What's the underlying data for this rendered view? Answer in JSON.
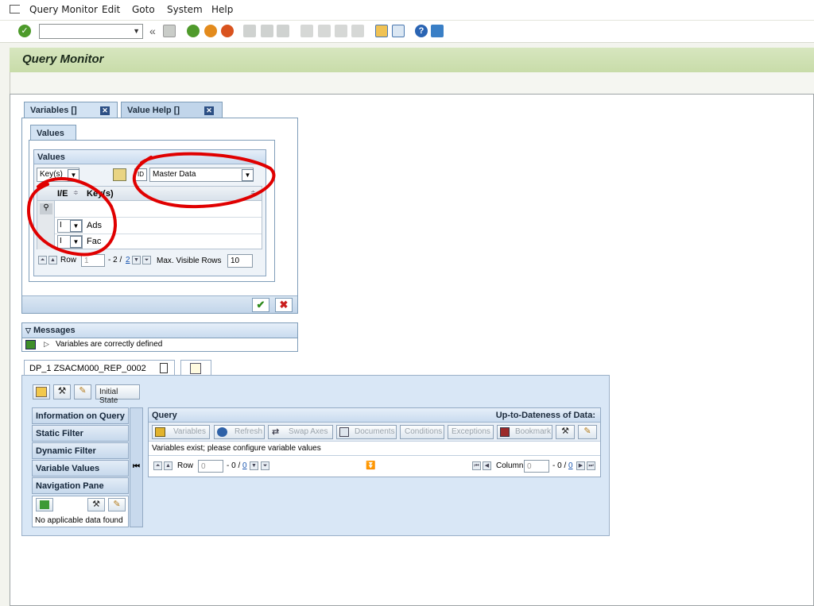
{
  "menu": {
    "items": [
      "Query Monitor",
      "Edit",
      "Goto",
      "System",
      "Help"
    ]
  },
  "toolbar": {
    "command_value": ""
  },
  "title": "Query Monitor",
  "tabs": [
    {
      "label": "Variables []"
    },
    {
      "label": "Value Help []"
    }
  ],
  "values_tab": "Values",
  "values_group": {
    "title": "Values",
    "key_select": "Key(s)",
    "id_label": "ID",
    "master_data_select": "Master Data",
    "columns": [
      "I/E",
      "Key(s)"
    ],
    "rows": [
      {
        "ie": "I",
        "key": "Ads"
      },
      {
        "ie": "I",
        "key": "Fac"
      }
    ],
    "nav": {
      "row_label": "Row",
      "row_value": "1",
      "count": "- 2 /",
      "total": "2",
      "max_label": "Max. Visible Rows",
      "max_value": "10"
    }
  },
  "messages": {
    "title": "Messages",
    "text": "Variables are correctly defined"
  },
  "dp_tab": {
    "label": "DP_1 ZSACM000_REP_0002"
  },
  "initial_state": "Initial State",
  "side_buttons": [
    "Information on Query",
    "Static Filter",
    "Dynamic Filter",
    "Variable Values",
    "Navigation Pane"
  ],
  "no_data": "No applicable data found",
  "query": {
    "title": "Query",
    "uptodate": "Up-to-Dateness of Data:",
    "buttons": [
      "Variables",
      "Refresh",
      "Swap Axes",
      "Documents",
      "Conditions",
      "Exceptions",
      "Bookmark"
    ],
    "info": "Variables exist; please configure variable values",
    "row_label": "Row",
    "row_value": "0",
    "row_count": "- 0 /",
    "row_total": "0",
    "col_label": "Column",
    "col_value": "0",
    "col_count": "- 0 /",
    "col_total": "0"
  },
  "colors": {
    "accent_green": "#c8dca9",
    "sap_blue": "#c9dbef",
    "annotation_red": "#e00000"
  }
}
